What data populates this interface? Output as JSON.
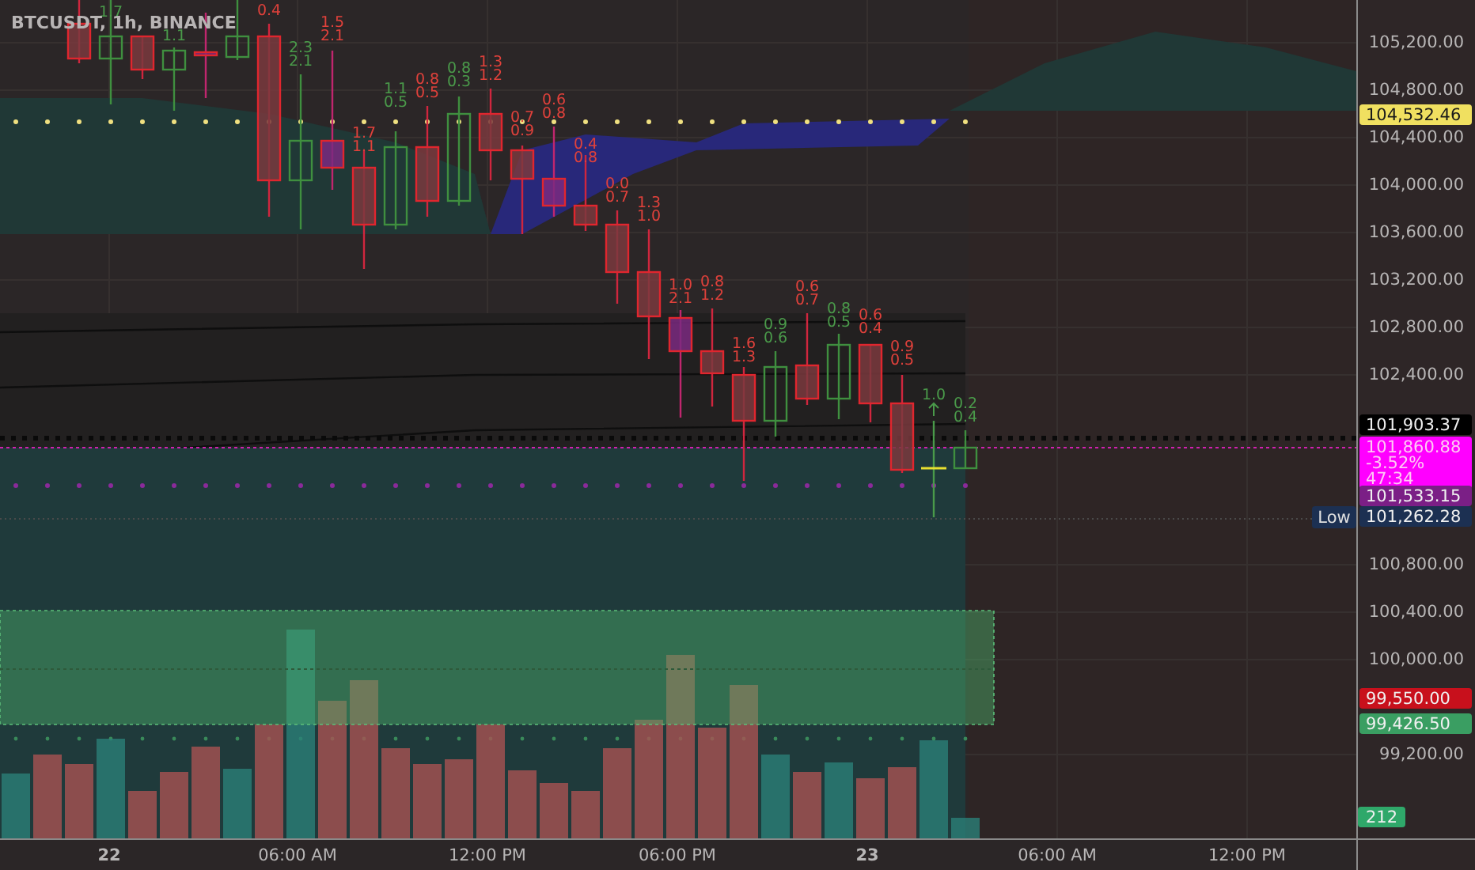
{
  "chart": {
    "title": "BTCUSDT, 1h, BINANCE",
    "candles": [
      {
        "kind": "bear"
      },
      {
        "kind": "bull",
        "labels": [
          "1.7"
        ]
      },
      {
        "kind": "bear"
      },
      {
        "kind": "bull",
        "labels": [
          "1.1"
        ]
      },
      {
        "kind": "purple"
      },
      {
        "kind": "bull"
      },
      {
        "kind": "bear",
        "labels": [
          "0.4"
        ]
      },
      {
        "kind": "bull",
        "labels": [
          "2.3",
          "2.1"
        ]
      },
      {
        "kind": "purple",
        "labels": [
          "1.5",
          "2.1"
        ]
      },
      {
        "kind": "bear",
        "labels": [
          "1.7",
          "1.1"
        ]
      },
      {
        "kind": "bull",
        "labels": [
          "1.1",
          "0.5"
        ]
      },
      {
        "kind": "bear",
        "labels": [
          "0.8",
          "0.5"
        ]
      },
      {
        "kind": "bull",
        "labels": [
          "0.8",
          "0.3"
        ]
      },
      {
        "kind": "bear",
        "labels": [
          "1.3",
          "1.2"
        ]
      },
      {
        "kind": "bear",
        "labels": [
          "0.7",
          "0.9"
        ]
      },
      {
        "kind": "purple",
        "labels": [
          "0.6",
          "0.8"
        ]
      },
      {
        "kind": "bear",
        "labels": [
          "0.4",
          "0.8"
        ]
      },
      {
        "kind": "bear",
        "labels": [
          "0.0",
          "0.7"
        ]
      },
      {
        "kind": "bear",
        "labels": [
          "1.3",
          "1.0"
        ]
      },
      {
        "kind": "purple",
        "labels": [
          "1.0",
          "2.1"
        ]
      },
      {
        "kind": "bear",
        "labels": [
          "0.8",
          "1.2"
        ]
      },
      {
        "kind": "bear",
        "labels": [
          "1.6",
          "1.3"
        ]
      },
      {
        "kind": "bull",
        "labels": [
          "0.9",
          "0.6"
        ]
      },
      {
        "kind": "bear",
        "labels": [
          "0.6",
          "0.7"
        ]
      },
      {
        "kind": "bull",
        "labels": [
          "0.8",
          "0.5"
        ]
      },
      {
        "kind": "bear",
        "labels": [
          "0.6",
          "0.4"
        ]
      },
      {
        "kind": "bear",
        "labels": [
          "0.9",
          "0.5"
        ]
      },
      {
        "kind": "doji",
        "labels": [
          "1.0"
        ]
      },
      {
        "kind": "bull",
        "labels": [
          "0.2",
          "0.4"
        ]
      }
    ]
  },
  "price_axis": {
    "ticks": [
      "105,200.00",
      "104,800.00",
      "104,400.00",
      "104,000.00",
      "103,600.00",
      "103,200.00",
      "102,800.00",
      "102,400.00",
      "100,800.00",
      "100,400.00",
      "100,000.00",
      "99,200.00"
    ]
  },
  "price_badges": [
    {
      "lines": [
        "104,532.46"
      ],
      "color": "#f0e060"
    },
    {
      "lines": [
        "101,903.37"
      ],
      "color": "#000000"
    },
    {
      "lines": [
        "101,860.88",
        "-3.52%",
        "47:34"
      ],
      "color": "#ff00ff"
    },
    {
      "lines": [
        "101,533.15"
      ],
      "color": "#7b1f86"
    },
    {
      "lines": [
        "101,262.28"
      ],
      "color": "#1c3052"
    },
    {
      "lines": [
        "99,550.00"
      ],
      "color": "#c8101c"
    },
    {
      "lines": [
        "99,426.50"
      ],
      "color": "#3a9e62"
    },
    {
      "lines": [
        "212"
      ],
      "color": "#2fa86a"
    }
  ],
  "low_tag": {
    "text": "Low"
  },
  "time_axis": {
    "labels": [
      {
        "text": "22",
        "kind": "day"
      },
      {
        "text": "06:00 AM",
        "kind": "time"
      },
      {
        "text": "12:00 PM",
        "kind": "time"
      },
      {
        "text": "06:00 PM",
        "kind": "time"
      },
      {
        "text": "23",
        "kind": "day"
      },
      {
        "text": "06:00 AM",
        "kind": "time"
      },
      {
        "text": "12:00 PM",
        "kind": "time"
      }
    ]
  }
}
